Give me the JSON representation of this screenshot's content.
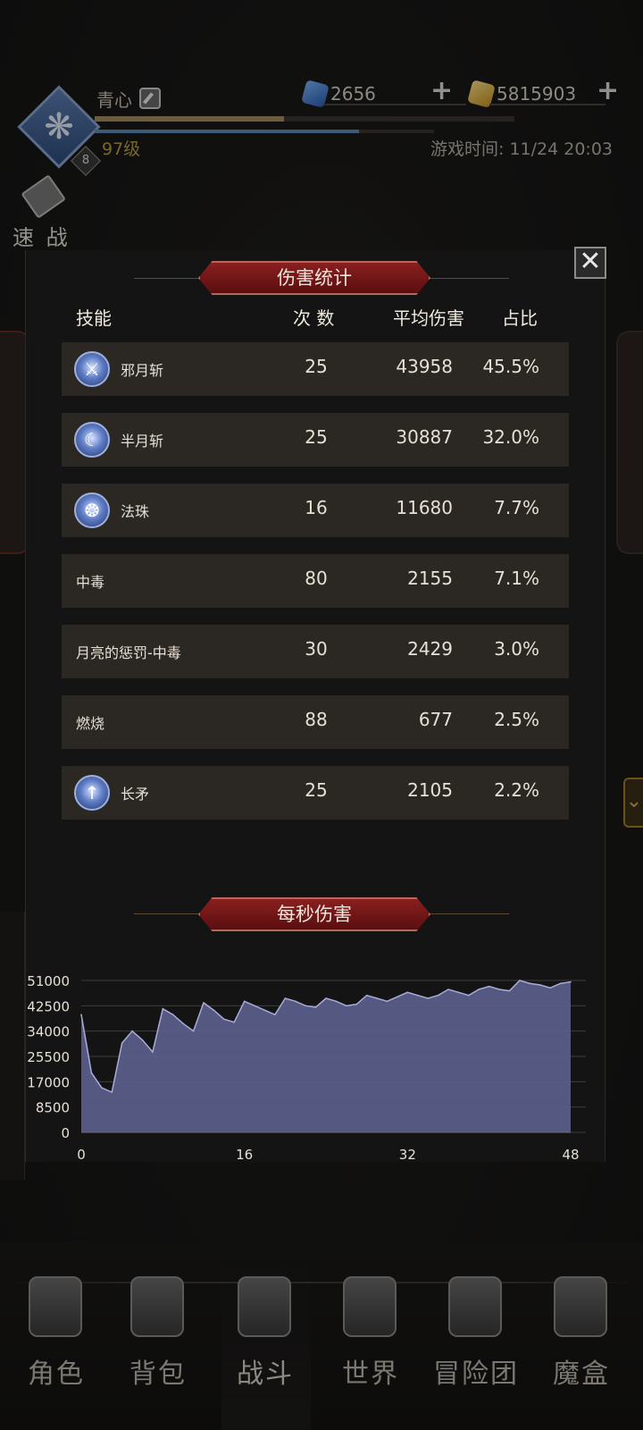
{
  "header": {
    "player_name": "青心",
    "level": "97级",
    "level_badge": "8",
    "game_time": "游戏时间: 11/24 20:03",
    "exp_fraction": 0.45,
    "mp_fraction": 0.78,
    "currency_diamond": "2656",
    "currency_gold": "5815903",
    "quick_battle_label": "速 战"
  },
  "modal": {
    "title": "伤害统计",
    "close_icon": "close-icon",
    "columns": {
      "skill": "技能",
      "count": "次 数",
      "avg": "平均伤害",
      "pct": "占比"
    },
    "rows": [
      {
        "name": "邪月斩",
        "icon": "sword-icon",
        "count": "25",
        "avg": "43958",
        "pct": "45.5%"
      },
      {
        "name": "半月斩",
        "icon": "crescent-icon",
        "count": "25",
        "avg": "30887",
        "pct": "32.0%"
      },
      {
        "name": "法珠",
        "icon": "orb-icon",
        "count": "16",
        "avg": "11680",
        "pct": "7.7%"
      },
      {
        "name": "中毒",
        "icon": "",
        "count": "80",
        "avg": "2155",
        "pct": "7.1%"
      },
      {
        "name": "月亮的惩罚-中毒",
        "icon": "",
        "count": "30",
        "avg": "2429",
        "pct": "3.0%"
      },
      {
        "name": "燃烧",
        "icon": "",
        "count": "88",
        "avg": "677",
        "pct": "2.5%"
      },
      {
        "name": "长矛",
        "icon": "spear-icon",
        "count": "25",
        "avg": "2105",
        "pct": "2.2%"
      }
    ],
    "dps_title": "每秒伤害"
  },
  "chart_data": {
    "type": "area",
    "title": "每秒伤害",
    "xlabel": "",
    "ylabel": "",
    "xlim": [
      0,
      48
    ],
    "ylim": [
      0,
      51000
    ],
    "x_ticks": [
      "0",
      "16",
      "32",
      "48"
    ],
    "y_ticks": [
      "51000",
      "42500",
      "34000",
      "25500",
      "17000",
      "8500",
      "0"
    ],
    "fill_color": "#5c5f8c",
    "line_color": "#a8acd8",
    "grid": true,
    "x": [
      0,
      1,
      2,
      3,
      4,
      5,
      6,
      7,
      8,
      9,
      10,
      11,
      12,
      13,
      14,
      15,
      16,
      17,
      18,
      19,
      20,
      21,
      22,
      23,
      24,
      25,
      26,
      27,
      28,
      29,
      30,
      31,
      32,
      33,
      34,
      35,
      36,
      37,
      38,
      39,
      40,
      41,
      42,
      43,
      44,
      45,
      46,
      47,
      48
    ],
    "y": [
      39500,
      20000,
      15000,
      13500,
      30000,
      34000,
      31000,
      27000,
      41500,
      39500,
      36500,
      34000,
      43500,
      41000,
      38000,
      37000,
      44000,
      42500,
      41000,
      39500,
      45000,
      44000,
      42500,
      42000,
      45000,
      44000,
      42500,
      43000,
      46000,
      45000,
      44000,
      45500,
      47000,
      46000,
      45000,
      46000,
      48000,
      47000,
      46000,
      48000,
      49000,
      48000,
      47500,
      51000,
      50000,
      49500,
      48500,
      50000,
      50500
    ]
  },
  "nav": [
    {
      "label": "角色",
      "icon": "helmet-icon"
    },
    {
      "label": "背包",
      "icon": "backpack-icon"
    },
    {
      "label": "战斗",
      "icon": "swords-icon"
    },
    {
      "label": "世界",
      "icon": "map-icon"
    },
    {
      "label": "冒险团",
      "icon": "castle-icon"
    },
    {
      "label": "魔盒",
      "icon": "cube-icon"
    }
  ]
}
